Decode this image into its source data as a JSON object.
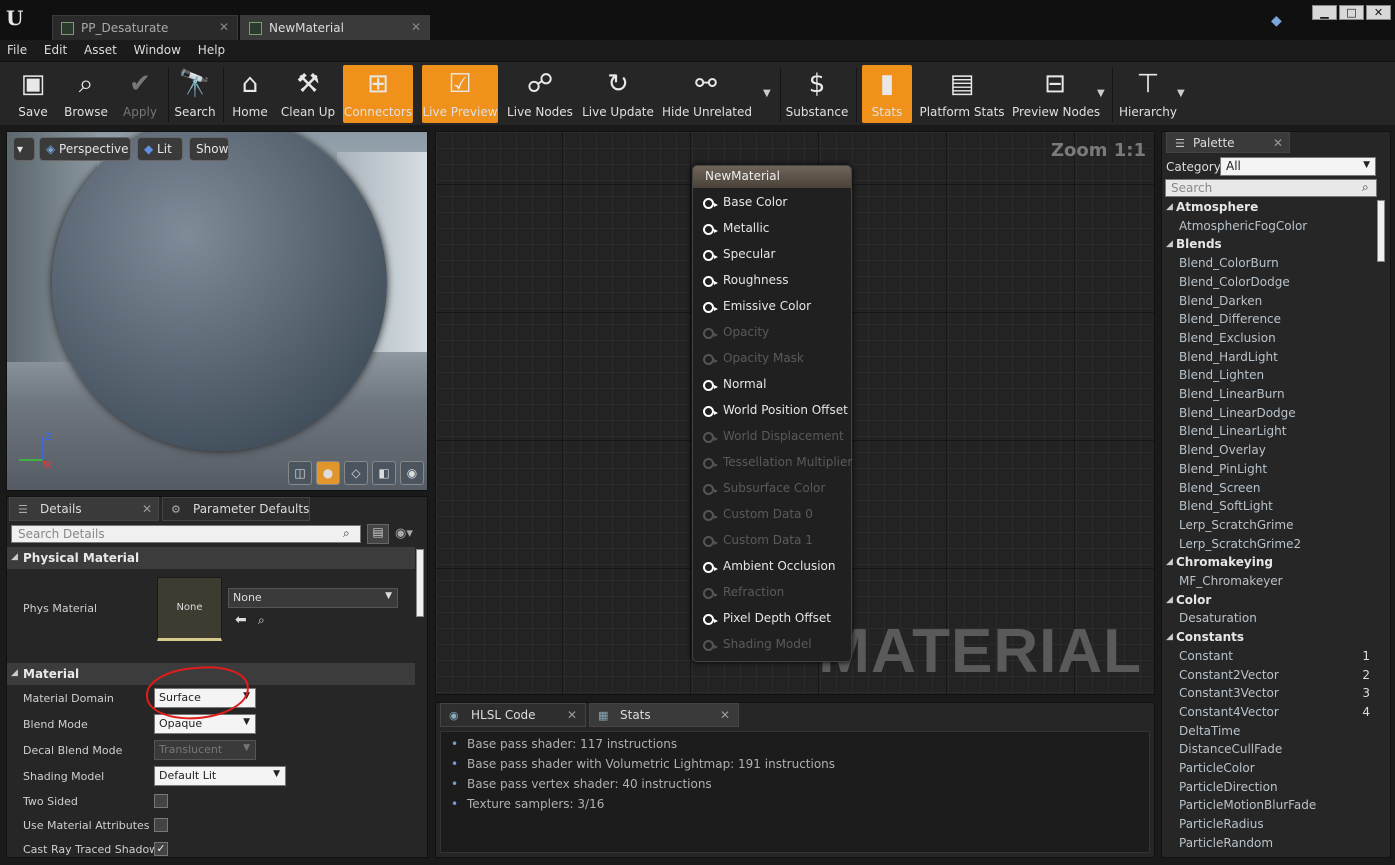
{
  "window": {
    "tabs": [
      "PP_Desaturate",
      "NewMaterial"
    ],
    "controls": [
      "▁",
      "□",
      "✕"
    ]
  },
  "menu": [
    "File",
    "Edit",
    "Asset",
    "Window",
    "Help"
  ],
  "toolbar": {
    "buttons": [
      {
        "label": "Save",
        "icon": "save-icon"
      },
      {
        "label": "Browse",
        "icon": "browse-icon"
      },
      {
        "label": "Apply",
        "icon": "apply-icon"
      },
      {
        "label": "Search",
        "icon": "search-icon"
      },
      {
        "label": "Home",
        "icon": "home-icon"
      },
      {
        "label": "Clean Up",
        "icon": "clean-up-icon"
      },
      {
        "label": "Connectors",
        "icon": "connectors-icon"
      },
      {
        "label": "Live Preview",
        "icon": "live-preview-icon"
      },
      {
        "label": "Live Nodes",
        "icon": "live-nodes-icon"
      },
      {
        "label": "Live Update",
        "icon": "live-update-icon"
      },
      {
        "label": "Hide Unrelated",
        "icon": "hide-unrelated-icon"
      },
      {
        "label": "Substance",
        "icon": "substance-icon"
      },
      {
        "label": "Stats",
        "icon": "stats-icon"
      },
      {
        "label": "Platform Stats",
        "icon": "platform-stats-icon"
      },
      {
        "label": "Preview Nodes",
        "icon": "preview-nodes-icon"
      },
      {
        "label": "Hierarchy",
        "icon": "hierarchy-icon"
      }
    ],
    "accent_color": "#f0911b"
  },
  "viewport": {
    "buttons": [
      "Perspective",
      "Lit",
      "Show"
    ]
  },
  "details": {
    "tabs": [
      "Details",
      "Parameter Defaults"
    ],
    "search_placeholder": "Search Details",
    "sections": {
      "physical_material": "Physical Material",
      "material": "Material"
    },
    "phys_material": {
      "label": "Phys Material",
      "thumb_text": "None",
      "value": "None"
    },
    "properties": [
      {
        "label": "Material Domain",
        "value": "Surface"
      },
      {
        "label": "Blend Mode",
        "value": "Opaque"
      },
      {
        "label": "Decal Blend Mode",
        "value": "Translucent"
      },
      {
        "label": "Shading Model",
        "value": "Default Lit"
      },
      {
        "label": "Two Sided",
        "checked": false
      },
      {
        "label": "Use Material Attributes",
        "checked": false
      },
      {
        "label": "Cast Ray Traced Shadow",
        "checked": true
      }
    ],
    "annotation_color": "#e21b1b"
  },
  "graph": {
    "zoom": "Zoom 1:1",
    "watermark": "MATERIAL",
    "node_title": "NewMaterial",
    "pins": [
      {
        "label": "Base Color",
        "enabled": true
      },
      {
        "label": "Metallic",
        "enabled": true
      },
      {
        "label": "Specular",
        "enabled": true
      },
      {
        "label": "Roughness",
        "enabled": true
      },
      {
        "label": "Emissive Color",
        "enabled": true
      },
      {
        "label": "Opacity",
        "enabled": false
      },
      {
        "label": "Opacity Mask",
        "enabled": false
      },
      {
        "label": "Normal",
        "enabled": true
      },
      {
        "label": "World Position Offset",
        "enabled": true
      },
      {
        "label": "World Displacement",
        "enabled": false
      },
      {
        "label": "Tessellation Multiplier",
        "enabled": false
      },
      {
        "label": "Subsurface Color",
        "enabled": false
      },
      {
        "label": "Custom Data 0",
        "enabled": false
      },
      {
        "label": "Custom Data 1",
        "enabled": false
      },
      {
        "label": "Ambient Occlusion",
        "enabled": true
      },
      {
        "label": "Refraction",
        "enabled": false
      },
      {
        "label": "Pixel Depth Offset",
        "enabled": true
      },
      {
        "label": "Shading Model",
        "enabled": false
      }
    ]
  },
  "stats": {
    "tabs": [
      "HLSL Code",
      "Stats"
    ],
    "lines": [
      "Base pass shader: 117 instructions",
      "Base pass shader with Volumetric Lightmap: 191 instructions",
      "Base pass vertex shader: 40 instructions",
      "Texture samplers: 3/16"
    ]
  },
  "palette": {
    "tab": "Palette",
    "category_label": "Category:",
    "category_value": "All",
    "search_placeholder": "Search",
    "rows": [
      {
        "type": "cat",
        "label": "Atmosphere"
      },
      {
        "type": "item",
        "label": "AtmosphericFogColor"
      },
      {
        "type": "cat",
        "label": "Blends"
      },
      {
        "type": "item",
        "label": "Blend_ColorBurn"
      },
      {
        "type": "item",
        "label": "Blend_ColorDodge"
      },
      {
        "type": "item",
        "label": "Blend_Darken"
      },
      {
        "type": "item",
        "label": "Blend_Difference"
      },
      {
        "type": "item",
        "label": "Blend_Exclusion"
      },
      {
        "type": "item",
        "label": "Blend_HardLight"
      },
      {
        "type": "item",
        "label": "Blend_Lighten"
      },
      {
        "type": "item",
        "label": "Blend_LinearBurn"
      },
      {
        "type": "item",
        "label": "Blend_LinearDodge"
      },
      {
        "type": "item",
        "label": "Blend_LinearLight"
      },
      {
        "type": "item",
        "label": "Blend_Overlay"
      },
      {
        "type": "item",
        "label": "Blend_PinLight"
      },
      {
        "type": "item",
        "label": "Blend_Screen"
      },
      {
        "type": "item",
        "label": "Blend_SoftLight"
      },
      {
        "type": "item",
        "label": "Lerp_ScratchGrime"
      },
      {
        "type": "item",
        "label": "Lerp_ScratchGrime2"
      },
      {
        "type": "cat",
        "label": "Chromakeying"
      },
      {
        "type": "item",
        "label": "MF_Chromakeyer"
      },
      {
        "type": "cat",
        "label": "Color"
      },
      {
        "type": "item",
        "label": "Desaturation"
      },
      {
        "type": "cat",
        "label": "Constants"
      },
      {
        "type": "item",
        "label": "Constant",
        "hotkey": "1"
      },
      {
        "type": "item",
        "label": "Constant2Vector",
        "hotkey": "2"
      },
      {
        "type": "item",
        "label": "Constant3Vector",
        "hotkey": "3"
      },
      {
        "type": "item",
        "label": "Constant4Vector",
        "hotkey": "4"
      },
      {
        "type": "item",
        "label": "DeltaTime"
      },
      {
        "type": "item",
        "label": "DistanceCullFade"
      },
      {
        "type": "item",
        "label": "ParticleColor"
      },
      {
        "type": "item",
        "label": "ParticleDirection"
      },
      {
        "type": "item",
        "label": "ParticleMotionBlurFade"
      },
      {
        "type": "item",
        "label": "ParticleRadius"
      },
      {
        "type": "item",
        "label": "ParticleRandom"
      }
    ]
  }
}
